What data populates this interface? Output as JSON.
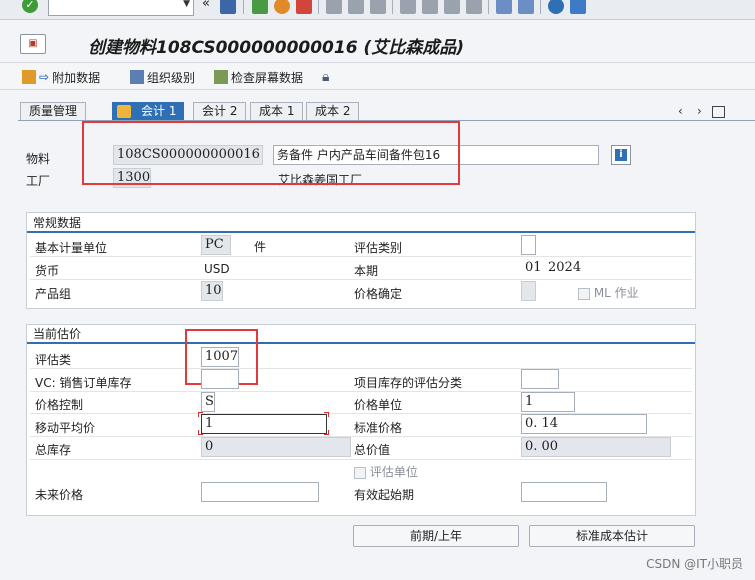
{
  "window": {
    "title": "创建物料108CS000000000016 (艾比森成品)"
  },
  "app_toolbar": {
    "additional_data": "附加数据",
    "org_levels": "组织级别",
    "check_screen": "检查屏幕数据"
  },
  "tabs": [
    {
      "label": "质量管理",
      "active": false
    },
    {
      "label": "会计 1",
      "active": true
    },
    {
      "label": "会计 2",
      "active": false
    },
    {
      "label": "成本 1",
      "active": false
    },
    {
      "label": "成本 2",
      "active": false
    }
  ],
  "header": {
    "material_label": "物料",
    "material_value": "108CS000000000016",
    "material_desc": "务备件 户内产品车间备件包16",
    "plant_label": "工厂",
    "plant_value": "1300",
    "plant_desc": "艾比森姜国工厂"
  },
  "general": {
    "title": "常规数据",
    "base_uom_label": "基本计量单位",
    "base_uom_value": "PC",
    "base_uom_text": "件",
    "valuation_category_label": "评估类别",
    "valuation_category_value": "",
    "currency_label": "货币",
    "currency_value": "USD",
    "current_period_label": "本期",
    "current_period_month": "01",
    "current_period_year": "2024",
    "product_group_label": "产品组",
    "product_group_value": "10",
    "price_determination_label": "价格确定",
    "price_determination_value": "",
    "ml_label": "ML 作业"
  },
  "valuation": {
    "title": "当前估价",
    "valuation_class_label": "评估类",
    "valuation_class_value": "1007",
    "vc_label": "VC: 销售订单库存",
    "vc_value": "",
    "proj_stock_label": "项目库存的评估分类",
    "proj_stock_value": "",
    "price_control_label": "价格控制",
    "price_control_value": "S",
    "price_unit_label": "价格单位",
    "price_unit_value": "1",
    "moving_avg_label": "移动平均价",
    "moving_avg_value": "1",
    "standard_price_label": "标准价格",
    "standard_price_value": "0. 14",
    "total_stock_label": "总库存",
    "total_stock_value": "0",
    "total_value_label": "总价值",
    "total_value_value": "0. 00",
    "val_unit_label": "评估单位",
    "future_price_label": "未来价格",
    "future_price_value": "",
    "valid_from_label": "有效起始期",
    "valid_from_value": ""
  },
  "buttons": {
    "prev_period": "前期/上年",
    "std_cost_estimate": "标准成本估计"
  },
  "watermark": "CSDN @IT小职员",
  "colors": {
    "accent": "#2f6fb5",
    "highlight": "#e23a3a"
  }
}
